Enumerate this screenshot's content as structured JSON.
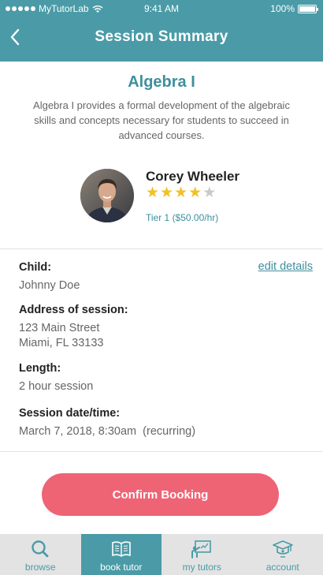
{
  "status_bar": {
    "carrier": "MyTutorLab",
    "time": "9:41 AM",
    "battery": "100%"
  },
  "nav": {
    "title": "Session Summary"
  },
  "course": {
    "title": "Algebra I",
    "description": "Algebra I provides a formal development of the algebraic skills and concepts necessary for students to succeed in advanced courses."
  },
  "tutor": {
    "name": "Corey Wheeler",
    "rating": 4,
    "rating_max": 5,
    "tier": "Tier 1 ($50.00/hr)"
  },
  "details": {
    "edit_label": "edit details",
    "child_label": "Child:",
    "child_value": "Johnny Doe",
    "address_label": "Address of session:",
    "address_line1": "123 Main Street",
    "address_line2": "Miami, FL 33133",
    "length_label": "Length:",
    "length_value": "2 hour session",
    "datetime_label": "Session date/time:",
    "datetime_value": "March 7, 2018, 8:30am  (recurring)"
  },
  "actions": {
    "confirm_label": "Confirm Booking"
  },
  "tabs": [
    {
      "label": "browse",
      "icon": "search-icon",
      "active": false
    },
    {
      "label": "book tutor",
      "icon": "book-icon",
      "active": true
    },
    {
      "label": "my tutors",
      "icon": "presentation-icon",
      "active": false
    },
    {
      "label": "account",
      "icon": "graduation-cap-icon",
      "active": false
    }
  ],
  "colors": {
    "brand": "#4a9ba7",
    "accent": "#ee6475",
    "star": "#f2c029"
  }
}
